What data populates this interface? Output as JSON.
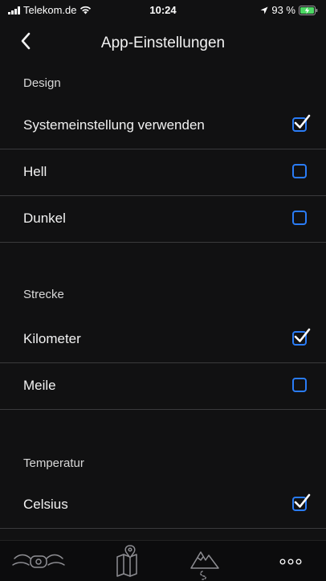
{
  "status": {
    "carrier": "Telekom.de",
    "time": "10:24",
    "battery": "93 %"
  },
  "nav": {
    "title": "App-Einstellungen",
    "back_icon": "chevron-left-icon"
  },
  "sections": {
    "design": {
      "header": "Design",
      "options": [
        {
          "label": "Systemeinstellung verwenden",
          "checked": true
        },
        {
          "label": "Hell",
          "checked": false
        },
        {
          "label": "Dunkel",
          "checked": false
        }
      ]
    },
    "distance": {
      "header": "Strecke",
      "options": [
        {
          "label": "Kilometer",
          "checked": true
        },
        {
          "label": "Meile",
          "checked": false
        }
      ]
    },
    "temperature": {
      "header": "Temperatur",
      "options": [
        {
          "label": "Celsius",
          "checked": true
        }
      ]
    }
  },
  "tabs": [
    {
      "icon": "scooter-icon"
    },
    {
      "icon": "map-pin-icon"
    },
    {
      "icon": "mountain-route-icon"
    },
    {
      "icon": "more-dots-icon"
    }
  ],
  "colors": {
    "background": "#111112",
    "accent": "#2a7cf6",
    "divider": "#3a3a3c"
  }
}
